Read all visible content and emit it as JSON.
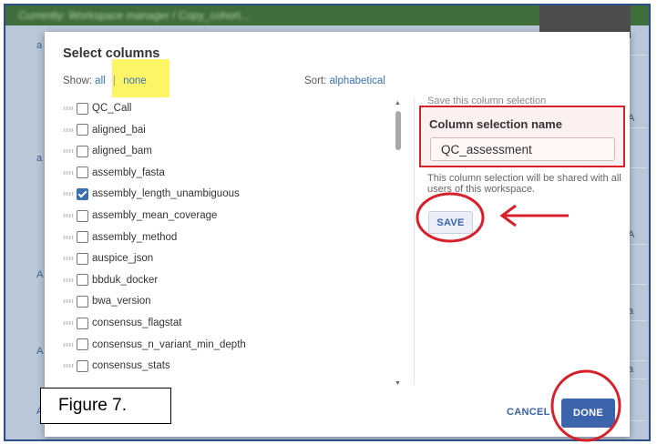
{
  "background": {
    "topbar_text": "Currently: Workspace manager / Copy_cohort...",
    "edge_letters": [
      "a",
      "A",
      "a",
      "A",
      "A",
      "a",
      "A",
      "a",
      "A"
    ]
  },
  "dialog": {
    "title": "Select columns",
    "show_label": "Show:",
    "show_all": "all",
    "show_separator": "|",
    "show_none": "none",
    "sort_label": "Sort:",
    "sort_value": "alphabetical"
  },
  "columns": [
    {
      "name": "QC_Call",
      "checked": false
    },
    {
      "name": "aligned_bai",
      "checked": false
    },
    {
      "name": "aligned_bam",
      "checked": false
    },
    {
      "name": "assembly_fasta",
      "checked": false
    },
    {
      "name": "assembly_length_unambiguous",
      "checked": true
    },
    {
      "name": "assembly_mean_coverage",
      "checked": false
    },
    {
      "name": "assembly_method",
      "checked": false
    },
    {
      "name": "auspice_json",
      "checked": false
    },
    {
      "name": "bbduk_docker",
      "checked": false
    },
    {
      "name": "bwa_version",
      "checked": false
    },
    {
      "name": "consensus_flagstat",
      "checked": false
    },
    {
      "name": "consensus_n_variant_min_depth",
      "checked": false
    },
    {
      "name": "consensus_stats",
      "checked": false
    }
  ],
  "save_panel": {
    "heading": "Save this column selection",
    "name_label": "Column selection name",
    "name_value": "QC_assessment",
    "shared_note": "This column selection will be shared with all users of this workspace.",
    "save_label": "SAVE"
  },
  "footer": {
    "cancel_label": "CANCEL",
    "done_label": "DONE"
  },
  "figure_label": "Figure 7.",
  "colors": {
    "annotation_red": "#d8202b",
    "highlight_yellow": "#fbf34a",
    "accent_blue": "#3b64ad"
  }
}
